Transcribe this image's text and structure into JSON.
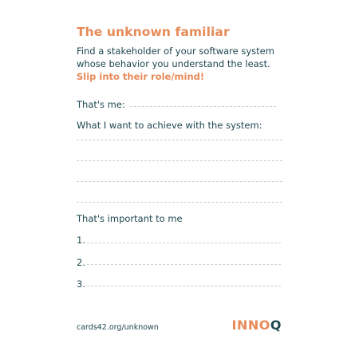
{
  "card": {
    "title": "The unknown familiar",
    "intro_line1": "Find a stakeholder of your software system",
    "intro_line2": "whose behavior you understand the least.",
    "intro_highlight": "Slip into their role/mind!",
    "thats_me_label": "That's me:",
    "goal_label": "What I want to achieve with the system:",
    "important_label": "That's important to me",
    "items": [
      "1.",
      "2.",
      "3."
    ],
    "footer_url": "cards42.org/unknown",
    "logo_part1": "INNO",
    "logo_part2": "Q"
  },
  "colors": {
    "accent": "#e78a58",
    "text": "#1f4650",
    "rule": "#c9d3d6"
  }
}
